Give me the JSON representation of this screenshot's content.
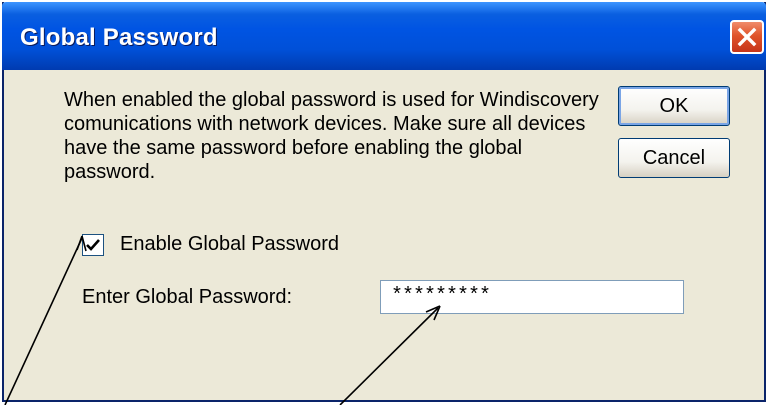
{
  "window": {
    "title": "Global Password"
  },
  "dialog": {
    "description": "When enabled the global password is used for Windiscovery comunications with network devices. Make sure all devices have the same password before enabling the global password.",
    "ok_label": "OK",
    "cancel_label": "Cancel",
    "enable_checkbox": {
      "label": "Enable Global Password",
      "checked": true
    },
    "password_label": "Enter Global Password:",
    "password_value": "*********"
  },
  "icons": {
    "close": "close-icon",
    "check": "checkmark-icon",
    "annotation": "arrow-annotation"
  },
  "colors": {
    "titlebar": "#0054e3",
    "dialog_bg": "#ece9d8",
    "close_button": "#e0542a"
  }
}
